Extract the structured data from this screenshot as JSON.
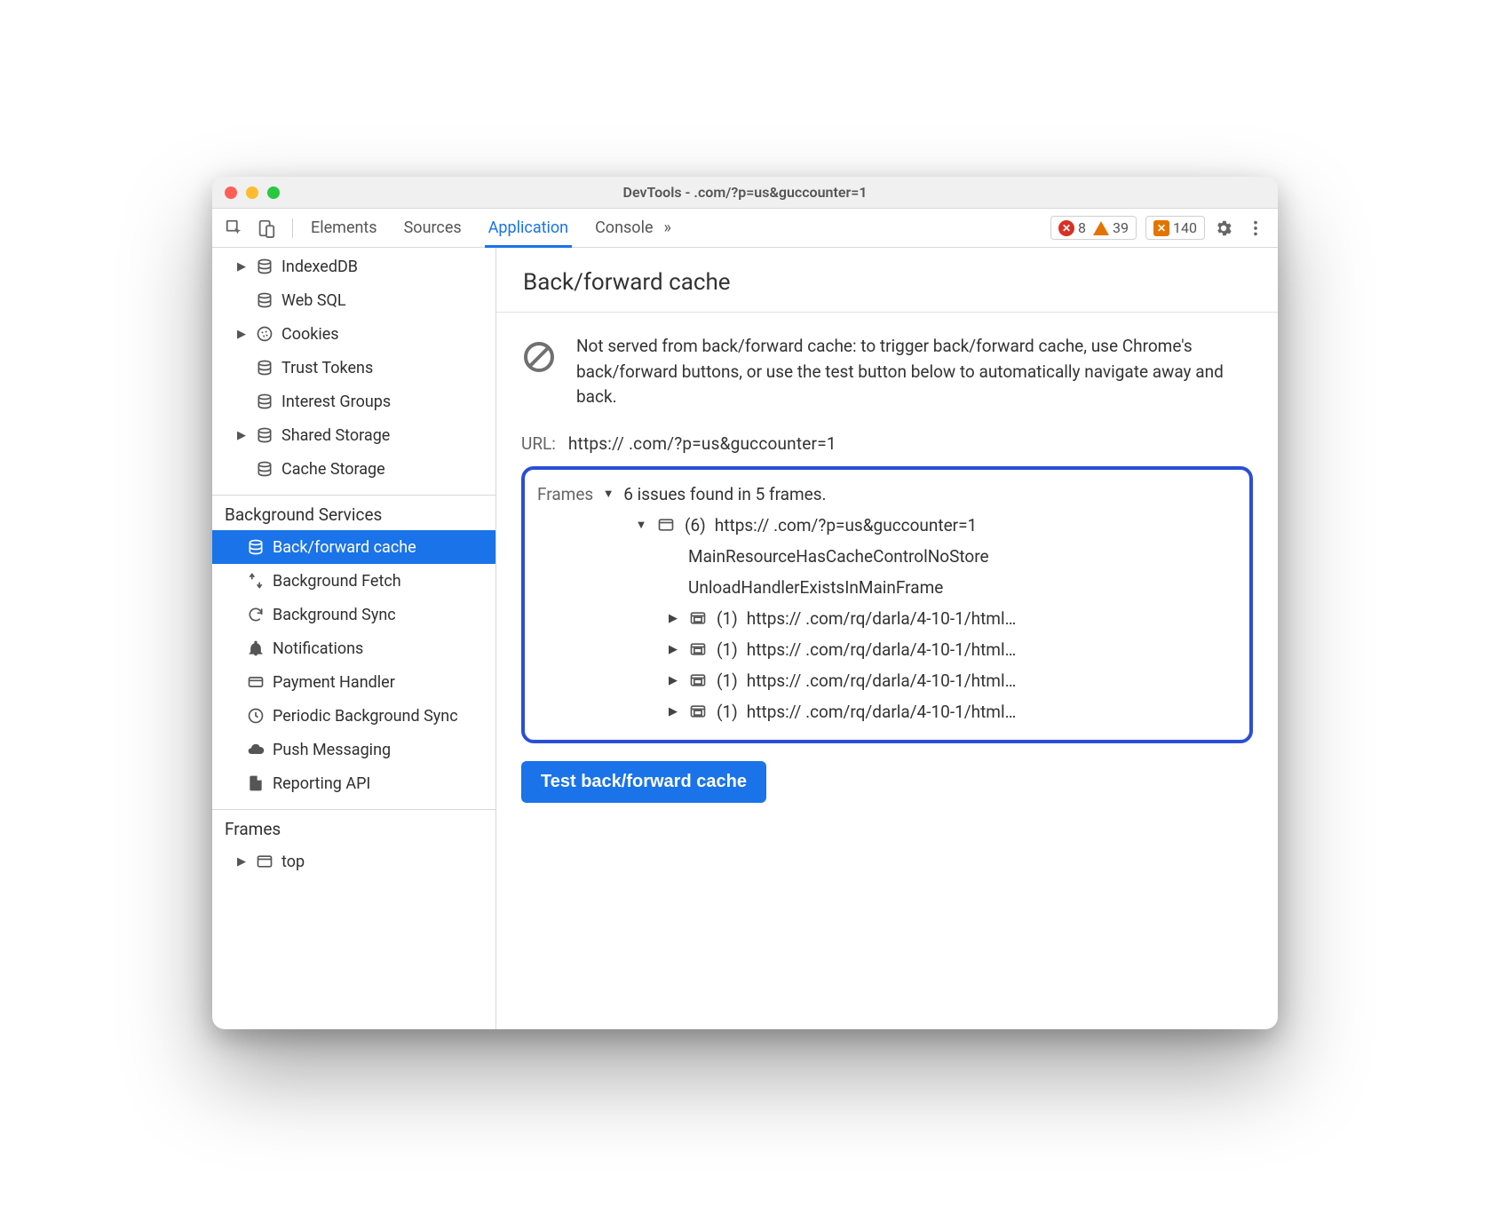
{
  "title": "DevTools -            .com/?p=us&guccounter=1",
  "toolbar": {
    "tabs": [
      "Elements",
      "Sources",
      "Application",
      "Console"
    ],
    "active_tab": 2,
    "errors": "8",
    "warnings": "39",
    "issues": "140"
  },
  "sidebar": {
    "storage_items": [
      {
        "label": "IndexedDB",
        "icon": "db",
        "expandable": true
      },
      {
        "label": "Web SQL",
        "icon": "db",
        "expandable": false
      },
      {
        "label": "Cookies",
        "icon": "cookie",
        "expandable": true
      },
      {
        "label": "Trust Tokens",
        "icon": "db",
        "expandable": false
      },
      {
        "label": "Interest Groups",
        "icon": "db",
        "expandable": false
      },
      {
        "label": "Shared Storage",
        "icon": "db",
        "expandable": true
      },
      {
        "label": "Cache Storage",
        "icon": "db",
        "expandable": false
      }
    ],
    "bg_header": "Background Services",
    "bg_items": [
      {
        "label": "Back/forward cache",
        "icon": "db",
        "selected": true
      },
      {
        "label": "Background Fetch",
        "icon": "fetch"
      },
      {
        "label": "Background Sync",
        "icon": "sync"
      },
      {
        "label": "Notifications",
        "icon": "bell"
      },
      {
        "label": "Payment Handler",
        "icon": "card"
      },
      {
        "label": "Periodic Background Sync",
        "icon": "clock"
      },
      {
        "label": "Push Messaging",
        "icon": "cloud"
      },
      {
        "label": "Reporting API",
        "icon": "file"
      }
    ],
    "frames_header": "Frames",
    "frames_items": [
      {
        "label": "top",
        "icon": "frame",
        "expandable": true
      }
    ]
  },
  "panel": {
    "title": "Back/forward cache",
    "notice": "Not served from back/forward cache: to trigger back/forward cache, use Chrome's back/forward buttons, or use the test button below to automatically navigate away and back.",
    "url_label": "URL:",
    "url_value": "https://            .com/?p=us&guccounter=1",
    "frames_label": "Frames",
    "frames_summary": "6 issues found in 5 frames.",
    "root_frame": {
      "count": "(6)",
      "url": "https://            .com/?p=us&guccounter=1"
    },
    "reasons": [
      "MainResourceHasCacheControlNoStore",
      "UnloadHandlerExistsInMainFrame"
    ],
    "subframes": [
      {
        "count": "(1)",
        "url": "https://        .com/rq/darla/4-10-1/html…"
      },
      {
        "count": "(1)",
        "url": "https://        .com/rq/darla/4-10-1/html…"
      },
      {
        "count": "(1)",
        "url": "https://        .com/rq/darla/4-10-1/html…"
      },
      {
        "count": "(1)",
        "url": "https://        .com/rq/darla/4-10-1/html…"
      }
    ],
    "test_button": "Test back/forward cache"
  }
}
